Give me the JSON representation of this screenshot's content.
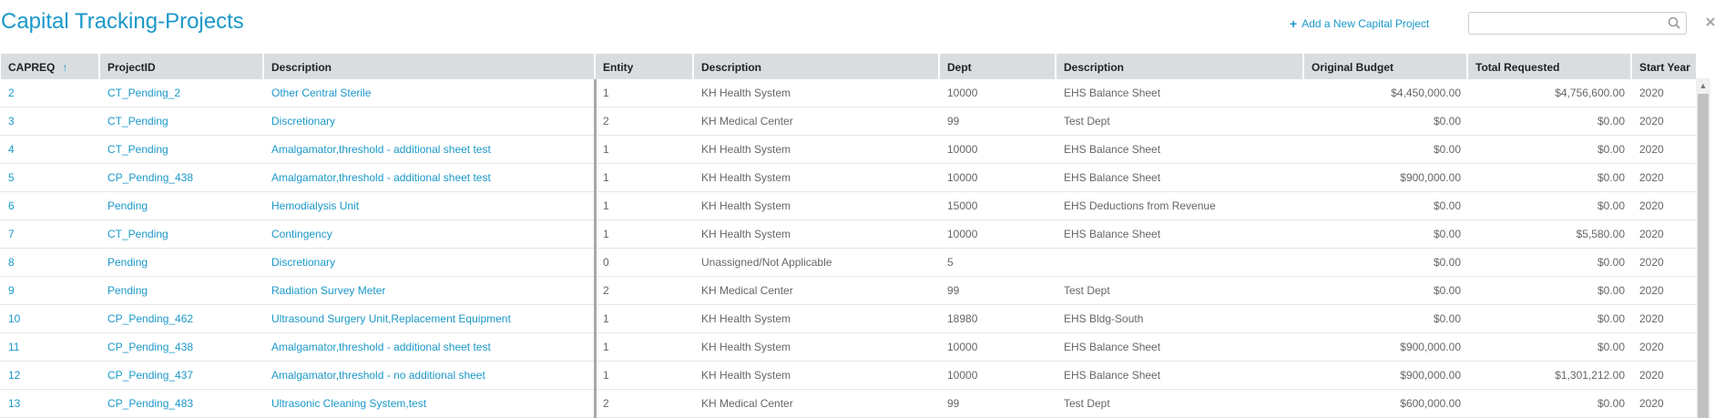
{
  "page": {
    "title": "Capital Tracking-Projects"
  },
  "toolbar": {
    "add_label": "Add a New Capital Project",
    "search_placeholder": "",
    "search_value": ""
  },
  "columns": [
    {
      "label": "CAPREQ",
      "sorted": "asc"
    },
    {
      "label": "ProjectID"
    },
    {
      "label": "Description"
    },
    {
      "label": "Entity"
    },
    {
      "label": "Description"
    },
    {
      "label": "Dept"
    },
    {
      "label": "Description"
    },
    {
      "label": "Original Budget"
    },
    {
      "label": "Total Requested"
    },
    {
      "label": "Start Year"
    }
  ],
  "rows": [
    [
      "2",
      "CT_Pending_2",
      "Other Central Sterile",
      "1",
      "KH Health System",
      "10000",
      "EHS Balance Sheet",
      "$4,450,000.00",
      "$4,756,600.00",
      "2020"
    ],
    [
      "3",
      "CT_Pending",
      "Discretionary",
      "2",
      "KH Medical Center",
      "99",
      "Test Dept",
      "$0.00",
      "$0.00",
      "2020"
    ],
    [
      "4",
      "CT_Pending",
      "Amalgamator,threshold - additional sheet test",
      "1",
      "KH Health System",
      "10000",
      "EHS Balance Sheet",
      "$0.00",
      "$0.00",
      "2020"
    ],
    [
      "5",
      "CP_Pending_438",
      "Amalgamator,threshold - additional sheet test",
      "1",
      "KH Health System",
      "10000",
      "EHS Balance Sheet",
      "$900,000.00",
      "$0.00",
      "2020"
    ],
    [
      "6",
      "Pending",
      "Hemodialysis Unit",
      "1",
      "KH Health System",
      "15000",
      "EHS Deductions from Revenue",
      "$0.00",
      "$0.00",
      "2020"
    ],
    [
      "7",
      "CT_Pending",
      "Contingency",
      "1",
      "KH Health System",
      "10000",
      "EHS Balance Sheet",
      "$0.00",
      "$5,580.00",
      "2020"
    ],
    [
      "8",
      "Pending",
      "Discretionary",
      "0",
      "Unassigned/Not Applicable",
      "5",
      "",
      "$0.00",
      "$0.00",
      "2020"
    ],
    [
      "9",
      "Pending",
      "Radiation Survey Meter",
      "2",
      "KH Medical Center",
      "99",
      "Test Dept",
      "$0.00",
      "$0.00",
      "2020"
    ],
    [
      "10",
      "CP_Pending_462",
      "Ultrasound Surgery Unit,Replacement Equipment",
      "1",
      "KH Health System",
      "18980",
      "EHS Bldg-South",
      "$0.00",
      "$0.00",
      "2020"
    ],
    [
      "11",
      "CP_Pending_438",
      "Amalgamator,threshold - additional sheet test",
      "1",
      "KH Health System",
      "10000",
      "EHS Balance Sheet",
      "$900,000.00",
      "$0.00",
      "2020"
    ],
    [
      "12",
      "CP_Pending_437",
      "Amalgamator,threshold - no additional sheet",
      "1",
      "KH Health System",
      "10000",
      "EHS Balance Sheet",
      "$900,000.00",
      "$1,301,212.00",
      "2020"
    ],
    [
      "13",
      "CP_Pending_483",
      "Ultrasonic Cleaning System,test",
      "2",
      "KH Medical Center",
      "99",
      "Test Dept",
      "$600,000.00",
      "$0.00",
      "2020"
    ]
  ],
  "icons": {
    "add": "plus-icon",
    "search": "search-icon",
    "clear": "close-icon",
    "sort": "sort-up-arrow-icon"
  },
  "colors": {
    "accent": "#1a98c9",
    "header_bg": "#d9dde0"
  }
}
